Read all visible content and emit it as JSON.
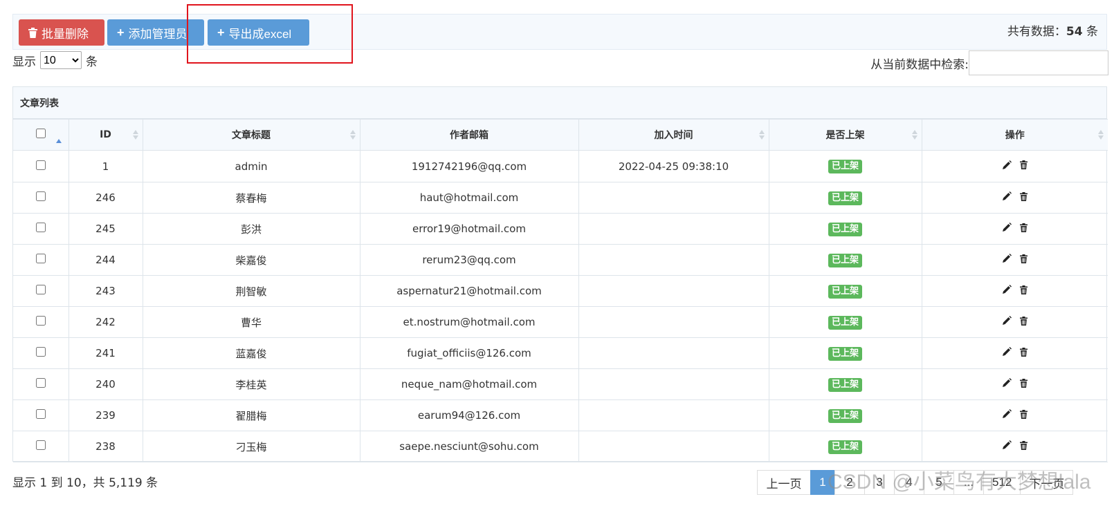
{
  "toolbar": {
    "batch_delete_label": "批量删除",
    "add_admin_label": "添加管理员",
    "export_excel_label": "导出成excel",
    "total_prefix": "共有数据：",
    "total_count": "54",
    "total_suffix": " 条"
  },
  "length": {
    "prefix": "显示",
    "selected": "10",
    "suffix": "条"
  },
  "search": {
    "label": "从当前数据中检索:",
    "value": ""
  },
  "panel": {
    "title": "文章列表"
  },
  "table": {
    "headers": [
      "ID",
      "文章标题",
      "作者邮箱",
      "加入时间",
      "是否上架",
      "操作"
    ],
    "rows": [
      {
        "id": "1",
        "title": "admin",
        "email": "1912742196@qq.com",
        "time": "2022-04-25 09:38:10",
        "status": "已上架"
      },
      {
        "id": "246",
        "title": "蔡春梅",
        "email": "haut@hotmail.com",
        "time": "",
        "status": "已上架"
      },
      {
        "id": "245",
        "title": "彭洪",
        "email": "error19@hotmail.com",
        "time": "",
        "status": "已上架"
      },
      {
        "id": "244",
        "title": "柴嘉俊",
        "email": "rerum23@qq.com",
        "time": "",
        "status": "已上架"
      },
      {
        "id": "243",
        "title": "荆智敏",
        "email": "aspernatur21@hotmail.com",
        "time": "",
        "status": "已上架"
      },
      {
        "id": "242",
        "title": "曹华",
        "email": "et.nostrum@hotmail.com",
        "time": "",
        "status": "已上架"
      },
      {
        "id": "241",
        "title": "蓝嘉俊",
        "email": "fugiat_officiis@126.com",
        "time": "",
        "status": "已上架"
      },
      {
        "id": "240",
        "title": "李桂英",
        "email": "neque_nam@hotmail.com",
        "time": "",
        "status": "已上架"
      },
      {
        "id": "239",
        "title": "翟腊梅",
        "email": "earum94@126.com",
        "time": "",
        "status": "已上架"
      },
      {
        "id": "238",
        "title": "刁玉梅",
        "email": "saepe.nesciunt@sohu.com",
        "time": "",
        "status": "已上架"
      }
    ]
  },
  "footer": {
    "info": "显示 1 到 10，共 5,119 条",
    "prev_label": "上一页",
    "pages": [
      "1",
      "2",
      "3",
      "4",
      "5",
      "...",
      "512"
    ],
    "next_label": "下一页",
    "watermark": "CSDN @小菜鸟有大梦想lala"
  },
  "colors": {
    "danger": "#d9534f",
    "primary": "#5a9bd8",
    "success": "#5cb85c",
    "highlight_box": "#e0141c"
  },
  "icons": {
    "delete": "trash-icon",
    "add": "plus-icon",
    "edit": "pencil-icon",
    "sort": "sort-icon"
  }
}
